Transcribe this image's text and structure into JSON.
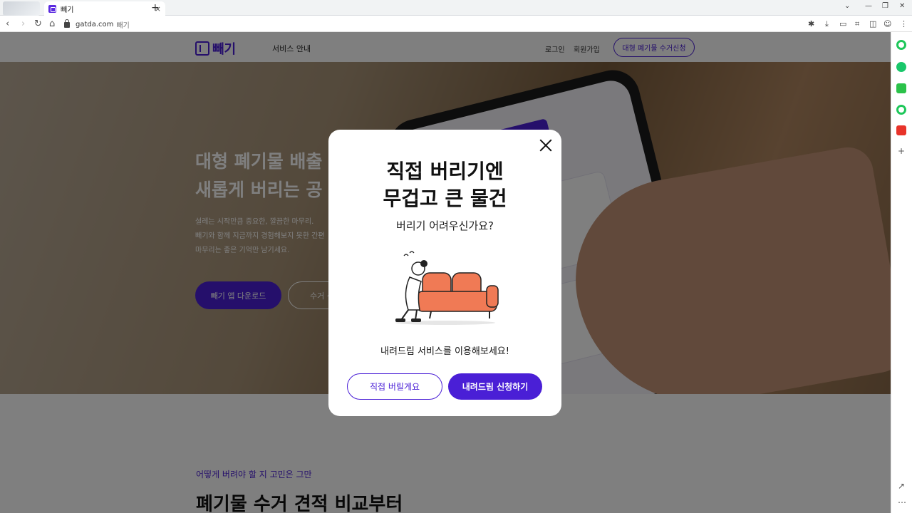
{
  "browser": {
    "tab_title": "빼기",
    "tab_close": "×",
    "new_tab": "+",
    "url_domain": "gatda.com",
    "url_title": "빼기"
  },
  "site": {
    "logo_text": "빼기",
    "nav_service": "서비스 안내",
    "nav_login": "로그인",
    "nav_signup": "회원가입",
    "nav_cta": "대형 폐기물 수거신청"
  },
  "hero": {
    "title_line1": "대형 폐기물 배출",
    "title_line2": "새롭게 버리는 공",
    "desc_line1": "설레는 시작만큼 중요한, 깔끔한 마무리.",
    "desc_line2": "빼기와 함께 지금까지 경험해보지 못한 간편",
    "desc_line3": "마무리는 좋은 기억만 남기세요.",
    "btn_app": "빼기 앱 다운로드",
    "btn_collect": "수거 신"
  },
  "section": {
    "subtitle": "어떻게 버려야 할 지 고민은 그만",
    "title": "폐기물 수거 견적 비교부터"
  },
  "modal": {
    "title_line1": "직접 버리기엔",
    "title_line2": "무겁고 큰 물건",
    "subtitle": "버리기 어려우신가요?",
    "note": "내려드림 서비스를 이용해보세요!",
    "btn_self": "직접 버릴게요",
    "btn_apply": "내려드림 신청하기"
  },
  "colors": {
    "brand": "#4a1fd6",
    "sofa": "#f07a55"
  }
}
